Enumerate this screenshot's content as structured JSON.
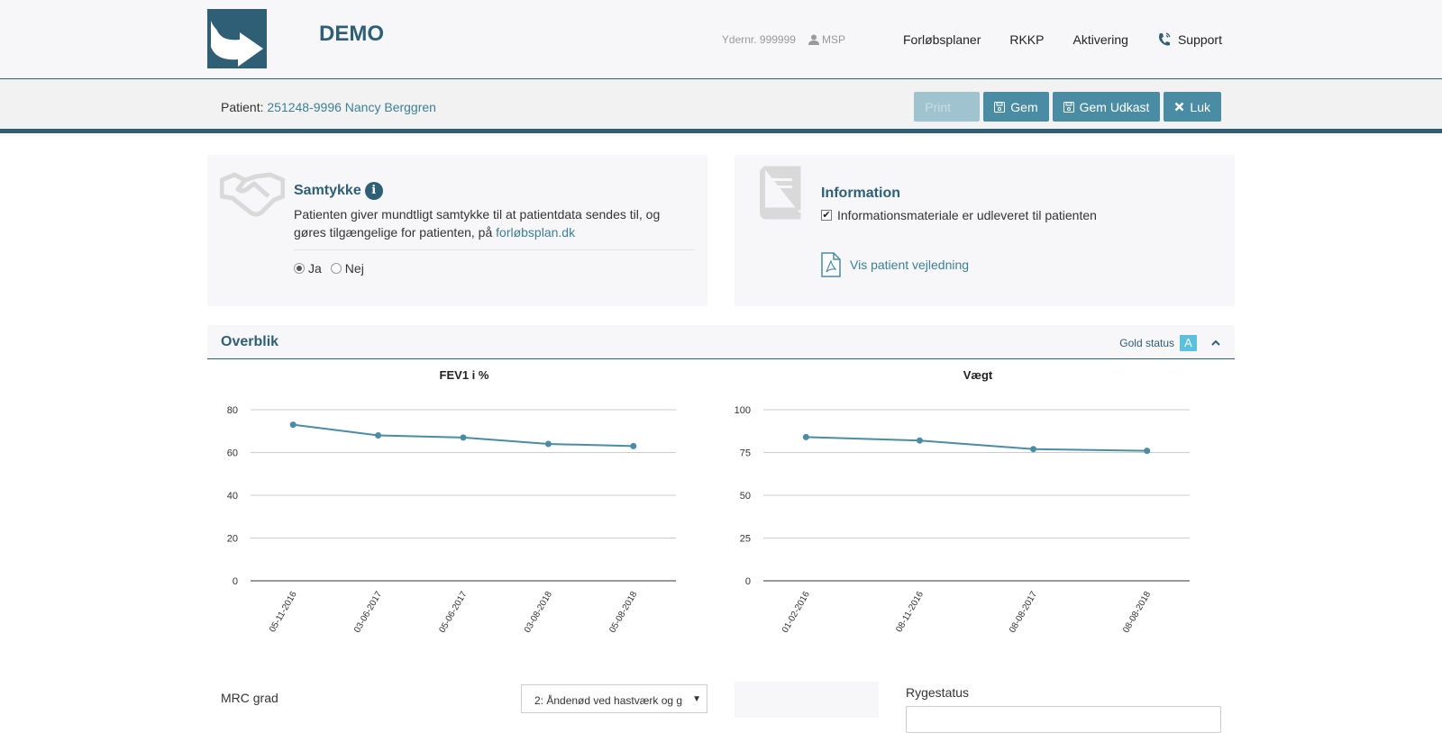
{
  "header": {
    "brand": "DEMO",
    "ydernr": "Ydernr. 999999",
    "user": "MSP",
    "nav": [
      "Forløbsplaner",
      "RKKP",
      "Aktivering",
      "Support"
    ]
  },
  "subbar": {
    "patient_label": "Patient:",
    "patient_value": "251248-9996 Nancy Berggren",
    "buttons": {
      "disabled_label": "Print",
      "save": "Gem",
      "save_draft": "Gem Udkast",
      "close": "Luk"
    }
  },
  "samtykke": {
    "title": "Samtykke",
    "text": "Patienten giver mundtligt samtykke til at patientdata sendes til, og gøres tilgængelige for patienten, på ",
    "link": "forløbsplan.dk",
    "options": [
      "Ja",
      "Nej"
    ],
    "selected": "Ja"
  },
  "information": {
    "title": "Information",
    "checkbox_label": "Informationsmateriale er udleveret til patienten",
    "checked": true,
    "pdf_link": "Vis patient vejledning"
  },
  "overblik": {
    "title": "Overblik",
    "gold_label": "Gold status",
    "gold_value": "A"
  },
  "chart_data": [
    {
      "type": "line",
      "title": "FEV1 i %",
      "x": [
        "05-11-2016",
        "03-06-2017",
        "05-06-2017",
        "03-08-2018",
        "05-08-2018"
      ],
      "values": [
        73,
        68,
        67,
        64,
        63
      ],
      "ylim": [
        0,
        80
      ],
      "yticks": [
        0,
        20,
        40,
        60,
        80
      ],
      "grid": true,
      "color": "#4a8ca3"
    },
    {
      "type": "line",
      "title": "Vægt",
      "x": [
        "01-02-2016",
        "08-11-2016",
        "08-08-2017",
        "08-08-2018"
      ],
      "values": [
        84,
        82,
        77,
        76
      ],
      "ylim": [
        0,
        100
      ],
      "yticks": [
        0,
        25,
        50,
        75,
        100
      ],
      "grid": true,
      "color": "#4a8ca3"
    }
  ],
  "bottom": {
    "mrc_label": "MRC grad",
    "mrc_value": "2: Åndenød ved hastværk og g",
    "ryge_label": "Rygestatus"
  },
  "colors": {
    "primary": "#2e5f74",
    "button": "#4a8ca3",
    "badge": "#5bc0de"
  }
}
